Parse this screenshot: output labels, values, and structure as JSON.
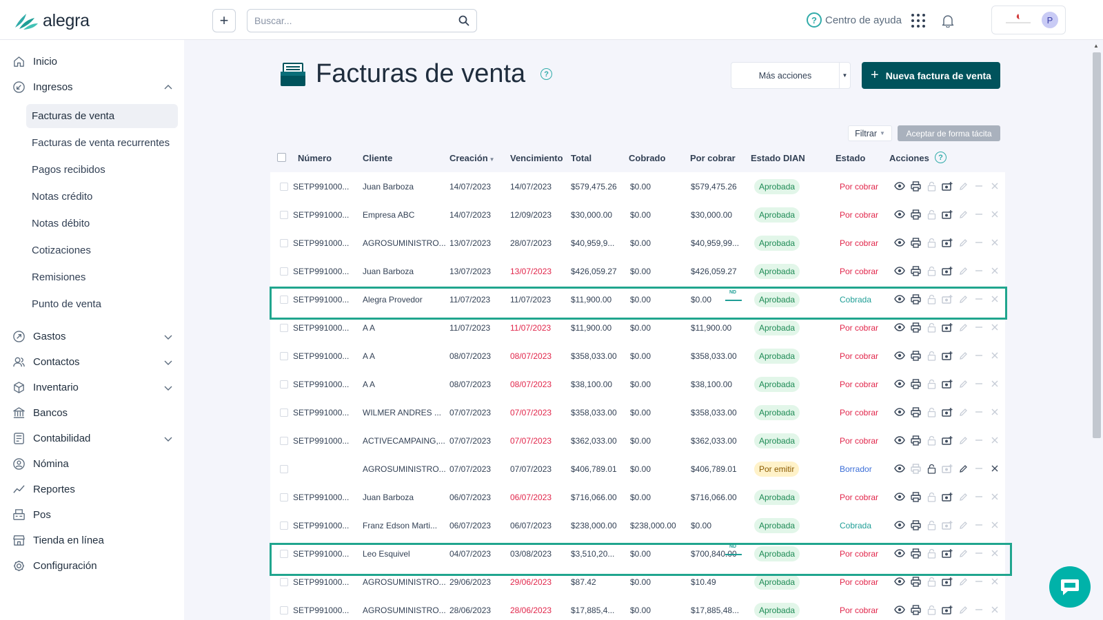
{
  "brand": {
    "name": "alegra",
    "accent": "#00535c",
    "teal": "#30aba9"
  },
  "header": {
    "search_placeholder": "Buscar...",
    "help_label": "Centro de ayuda",
    "avatar_initial": "P",
    "company_logo_text": "Empresa Ejemplar"
  },
  "sidebar": {
    "items": [
      {
        "label": "Inicio",
        "icon": "home-icon"
      },
      {
        "label": "Ingresos",
        "icon": "income-icon",
        "expanded": true
      },
      {
        "label": "Gastos",
        "icon": "expenses-icon"
      },
      {
        "label": "Contactos",
        "icon": "contacts-icon"
      },
      {
        "label": "Inventario",
        "icon": "inventory-icon"
      },
      {
        "label": "Bancos",
        "icon": "bank-icon"
      },
      {
        "label": "Contabilidad",
        "icon": "accounting-icon"
      },
      {
        "label": "Nómina",
        "icon": "payroll-icon"
      },
      {
        "label": "Reportes",
        "icon": "reports-icon"
      },
      {
        "label": "Pos",
        "icon": "pos-icon"
      },
      {
        "label": "Tienda en línea",
        "icon": "store-icon"
      },
      {
        "label": "Configuración",
        "icon": "settings-icon"
      }
    ],
    "sub_items": [
      "Facturas de venta",
      "Facturas de venta recurrentes",
      "Pagos recibidos",
      "Notas crédito",
      "Notas débito",
      "Cotizaciones",
      "Remisiones",
      "Punto de venta"
    ],
    "active_sub_item": "Facturas de venta"
  },
  "main": {
    "title": "Facturas de venta",
    "more_actions_label": "Más acciones",
    "new_invoice_label": "Nueva factura de venta",
    "filter_label": "Filtrar",
    "accept_label": "Aceptar de forma tácita"
  },
  "table": {
    "headers": [
      "Número",
      "Cliente",
      "Creación",
      "Vencimiento",
      "Total",
      "Cobrado",
      "Por cobrar",
      "Estado DIAN",
      "Estado",
      "Acciones"
    ],
    "rows": [
      {
        "numero": "SETP991000...",
        "cliente": "Juan Barboza",
        "creacion": "14/07/2023",
        "vencimiento": "14/07/2023",
        "venc_overdue": false,
        "total": "$579,475.26",
        "cobrado": "$0.00",
        "por_cobrar": "$579,475.26",
        "dian": "Aprobada",
        "estado": "Por cobrar"
      },
      {
        "numero": "SETP991000...",
        "cliente": "Empresa ABC",
        "creacion": "14/07/2023",
        "vencimiento": "12/09/2023",
        "venc_overdue": false,
        "total": "$30,000.00",
        "cobrado": "$0.00",
        "por_cobrar": "$30,000.00",
        "dian": "Aprobada",
        "estado": "Por cobrar"
      },
      {
        "numero": "SETP991000...",
        "cliente": "AGROSUMINISTRO...",
        "creacion": "13/07/2023",
        "vencimiento": "28/07/2023",
        "venc_overdue": false,
        "total": "$40,959,9...",
        "cobrado": "$0.00",
        "por_cobrar": "$40,959,99...",
        "dian": "Aprobada",
        "estado": "Por cobrar"
      },
      {
        "numero": "SETP991000...",
        "cliente": "Juan Barboza",
        "creacion": "13/07/2023",
        "vencimiento": "13/07/2023",
        "venc_overdue": true,
        "total": "$426,059.27",
        "cobrado": "$0.00",
        "por_cobrar": "$426,059.27",
        "dian": "Aprobada",
        "estado": "Por cobrar"
      },
      {
        "numero": "SETP991000...",
        "cliente": "Alegra Provedor",
        "creacion": "11/07/2023",
        "vencimiento": "11/07/2023",
        "venc_overdue": false,
        "total": "$11,900.00",
        "cobrado": "$0.00",
        "por_cobrar": "$0.00",
        "nd": "ND",
        "dian": "Aprobada",
        "estado": "Cobrada"
      },
      {
        "numero": "SETP991000...",
        "cliente": "A A",
        "creacion": "11/07/2023",
        "vencimiento": "11/07/2023",
        "venc_overdue": true,
        "total": "$11,900.00",
        "cobrado": "$0.00",
        "por_cobrar": "$11,900.00",
        "dian": "Aprobada",
        "estado": "Por cobrar"
      },
      {
        "numero": "SETP991000...",
        "cliente": "A A",
        "creacion": "08/07/2023",
        "vencimiento": "08/07/2023",
        "venc_overdue": true,
        "total": "$358,033.00",
        "cobrado": "$0.00",
        "por_cobrar": "$358,033.00",
        "dian": "Aprobada",
        "estado": "Por cobrar"
      },
      {
        "numero": "SETP991000...",
        "cliente": "A A",
        "creacion": "08/07/2023",
        "vencimiento": "08/07/2023",
        "venc_overdue": true,
        "total": "$38,100.00",
        "cobrado": "$0.00",
        "por_cobrar": "$38,100.00",
        "dian": "Aprobada",
        "estado": "Por cobrar"
      },
      {
        "numero": "SETP991000...",
        "cliente": "WILMER ANDRES ...",
        "creacion": "07/07/2023",
        "vencimiento": "07/07/2023",
        "venc_overdue": true,
        "total": "$358,033.00",
        "cobrado": "$0.00",
        "por_cobrar": "$358,033.00",
        "dian": "Aprobada",
        "estado": "Por cobrar"
      },
      {
        "numero": "SETP991000...",
        "cliente": "ACTIVECAMPAING,...",
        "creacion": "07/07/2023",
        "vencimiento": "07/07/2023",
        "venc_overdue": true,
        "total": "$362,033.00",
        "cobrado": "$0.00",
        "por_cobrar": "$362,033.00",
        "dian": "Aprobada",
        "estado": "Por cobrar"
      },
      {
        "numero": "",
        "cliente": "AGROSUMINISTRO...",
        "creacion": "07/07/2023",
        "vencimiento": "07/07/2023",
        "venc_overdue": false,
        "total": "$406,789.01",
        "cobrado": "$0.00",
        "por_cobrar": "$406,789.01",
        "dian": "Por emitir",
        "estado": "Borrador"
      },
      {
        "numero": "SETP991000...",
        "cliente": "Juan Barboza",
        "creacion": "06/07/2023",
        "vencimiento": "06/07/2023",
        "venc_overdue": true,
        "total": "$716,066.00",
        "cobrado": "$0.00",
        "por_cobrar": "$716,066.00",
        "dian": "Aprobada",
        "estado": "Por cobrar"
      },
      {
        "numero": "SETP991000...",
        "cliente": "Franz Edson Marti...",
        "creacion": "06/07/2023",
        "vencimiento": "06/07/2023",
        "venc_overdue": false,
        "total": "$238,000.00",
        "cobrado": "$238,000.00",
        "por_cobrar": "$0.00",
        "dian": "Aprobada",
        "estado": "Cobrada"
      },
      {
        "numero": "SETP991000...",
        "cliente": "Leo Esquivel",
        "creacion": "04/07/2023",
        "vencimiento": "03/08/2023",
        "venc_overdue": false,
        "total": "$3,510,20...",
        "cobrado": "$0.00",
        "por_cobrar": "$700,840.00",
        "nd": "ND",
        "dian": "Aprobada",
        "estado": "Por cobrar"
      },
      {
        "numero": "SETP991000...",
        "cliente": "AGROSUMINISTRO...",
        "creacion": "29/06/2023",
        "vencimiento": "29/06/2023",
        "venc_overdue": true,
        "total": "$87.42",
        "cobrado": "$0.00",
        "por_cobrar": "$10.49",
        "dian": "Aprobada",
        "estado": "Por cobrar"
      },
      {
        "numero": "SETP991000...",
        "cliente": "AGROSUMINISTRO...",
        "creacion": "28/06/2023",
        "vencimiento": "28/06/2023",
        "venc_overdue": true,
        "total": "$17,885,4...",
        "cobrado": "$0.00",
        "por_cobrar": "$17,885,48...",
        "dian": "Aprobada",
        "estado": "Por cobrar"
      }
    ],
    "action_icons": [
      "view-icon",
      "print-icon",
      "lock-icon",
      "payment-icon",
      "edit-icon",
      "minus-icon",
      "close-icon"
    ]
  }
}
